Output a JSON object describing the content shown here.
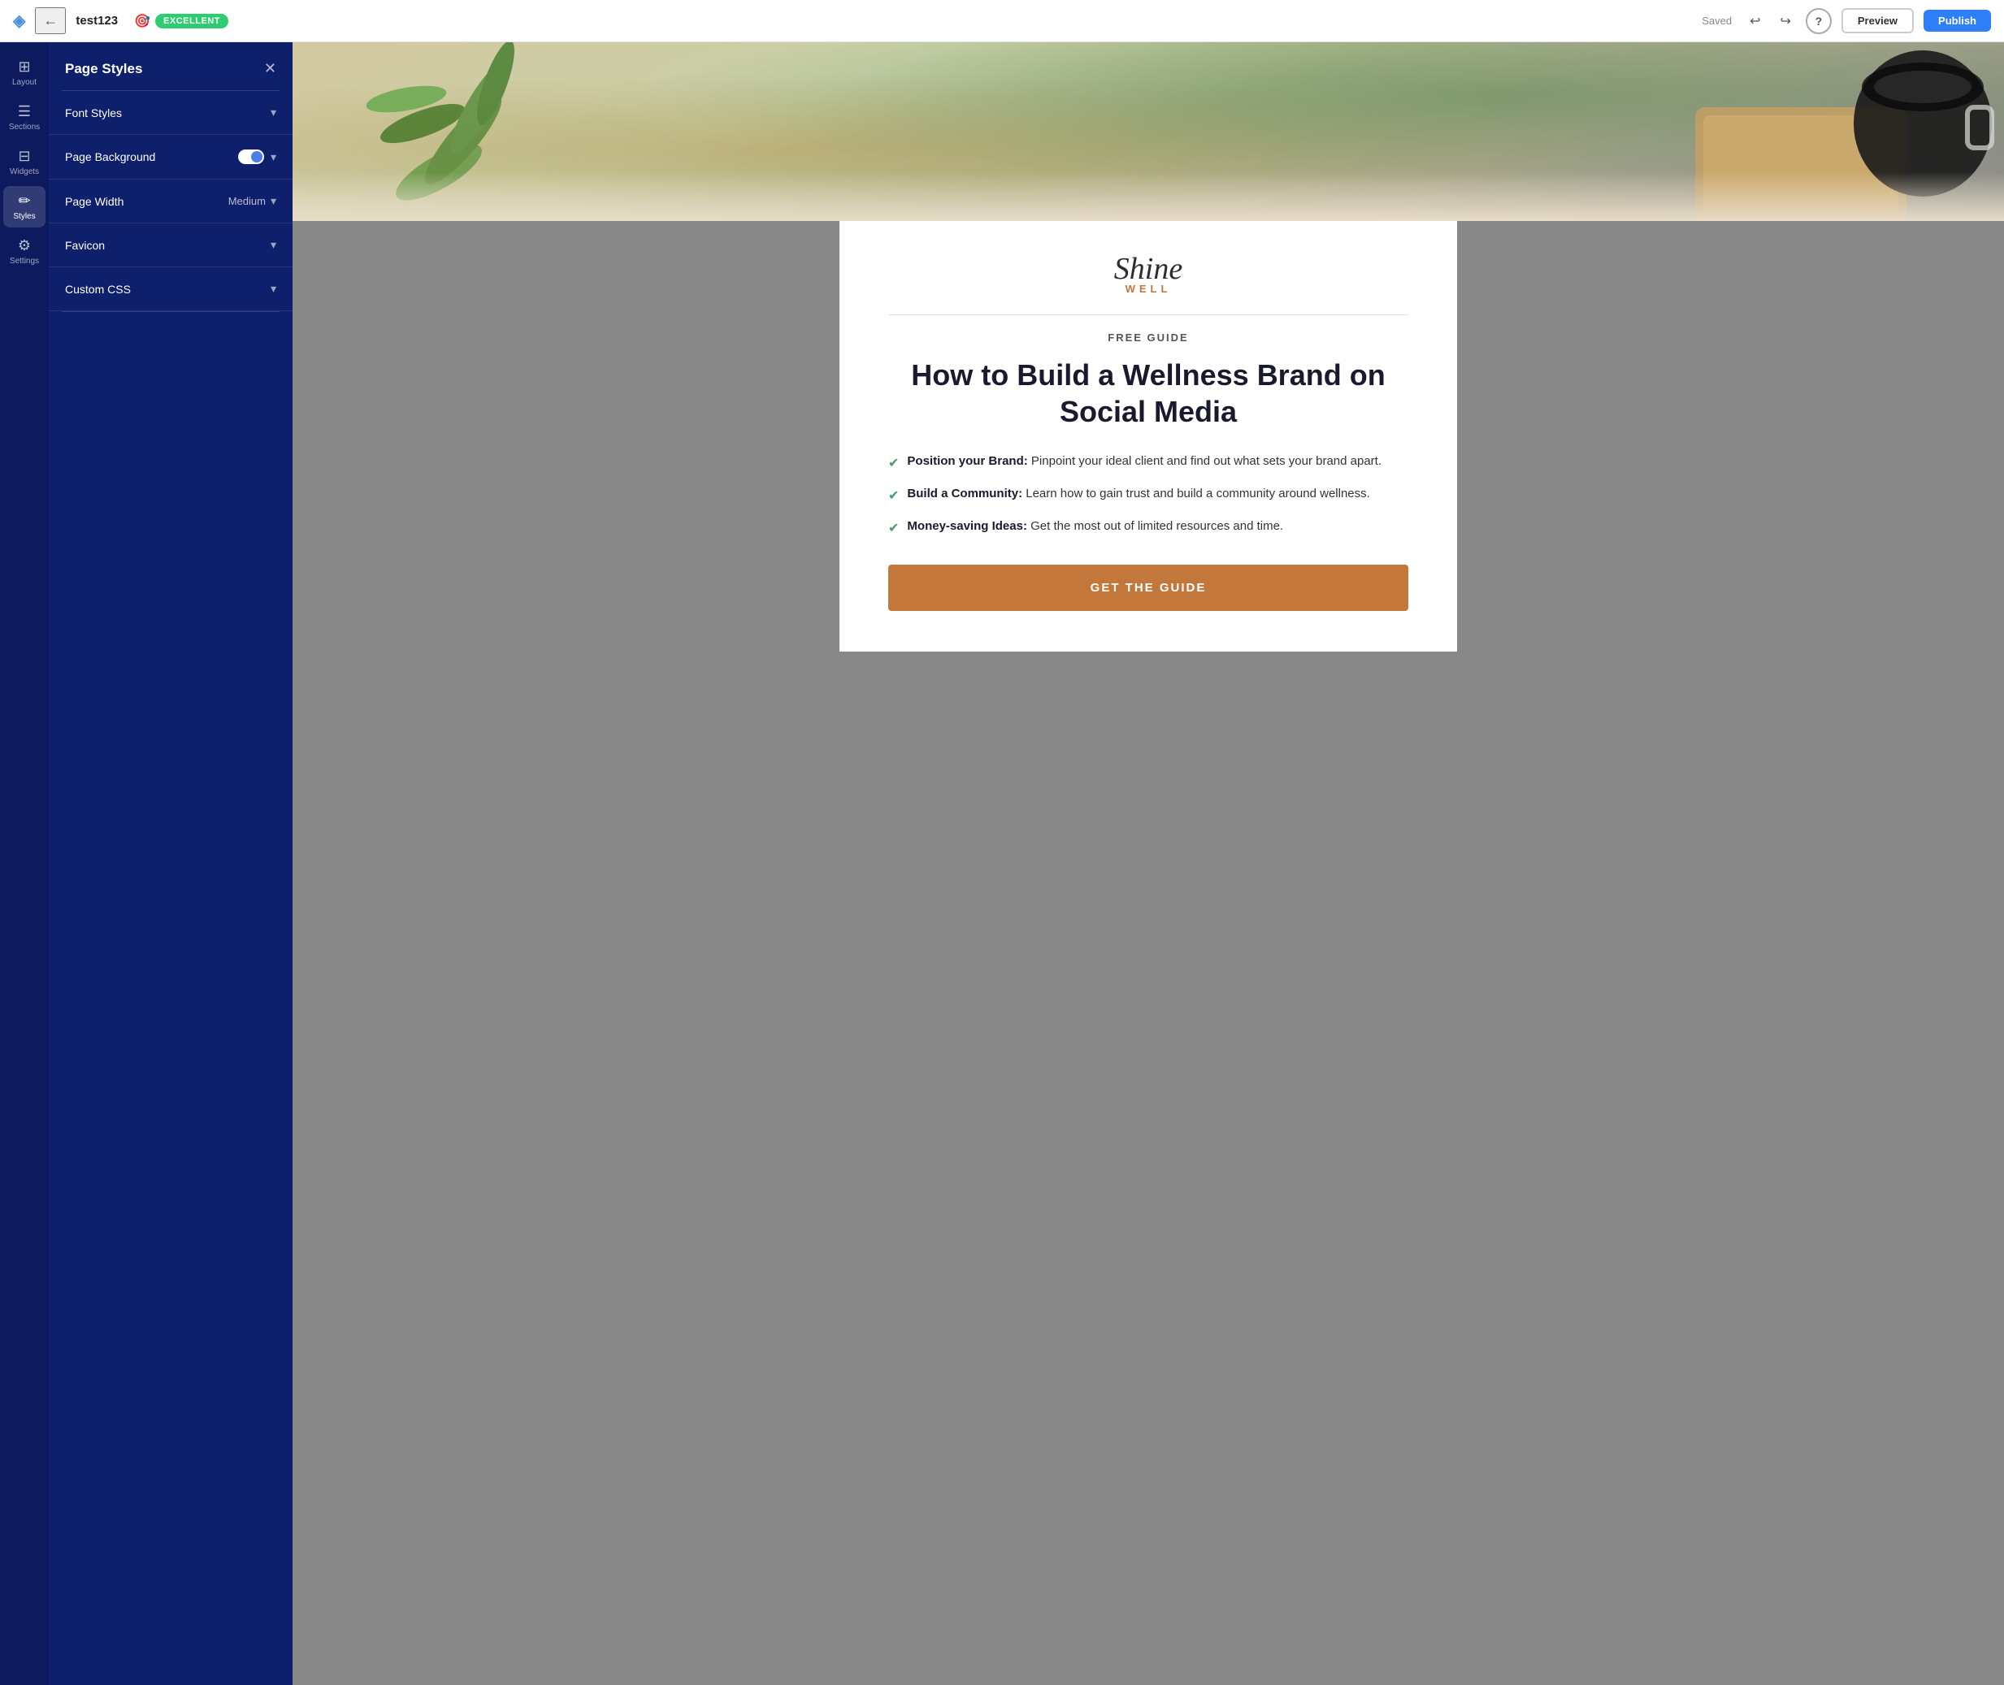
{
  "topbar": {
    "logo_symbol": "◈",
    "back_label": "←",
    "title": "test123",
    "target_icon": "⊕",
    "badge": "EXCELLENT",
    "saved_label": "Saved",
    "undo_label": "↩",
    "redo_label": "↪",
    "help_label": "?",
    "preview_label": "Preview",
    "publish_label": "Publish"
  },
  "icon_sidebar": {
    "items": [
      {
        "id": "layout",
        "icon": "⊞",
        "label": "Layout"
      },
      {
        "id": "sections",
        "icon": "≡",
        "label": "Sections"
      },
      {
        "id": "widgets",
        "icon": "⊟",
        "label": "Widgets"
      },
      {
        "id": "styles",
        "icon": "✏",
        "label": "Styles"
      },
      {
        "id": "settings",
        "icon": "⚙",
        "label": "Settings"
      }
    ]
  },
  "panel": {
    "title": "Page Styles",
    "close_label": "✕",
    "items": [
      {
        "id": "font-styles",
        "label": "Font Styles",
        "value": "",
        "has_toggle": false
      },
      {
        "id": "page-background",
        "label": "Page Background",
        "value": "",
        "has_toggle": true
      },
      {
        "id": "page-width",
        "label": "Page Width",
        "value": "Medium",
        "has_toggle": false
      },
      {
        "id": "favicon",
        "label": "Favicon",
        "value": "",
        "has_toggle": false
      },
      {
        "id": "custom-css",
        "label": "Custom CSS",
        "value": "",
        "has_toggle": false
      }
    ]
  },
  "landing": {
    "logo_script": "Shine",
    "logo_sub": "WELL",
    "tag": "FREE GUIDE",
    "headline": "How to Build a Wellness Brand on Social Media",
    "bullets": [
      {
        "bold": "Position your Brand:",
        "text": " Pinpoint your ideal client and find out what sets your brand apart."
      },
      {
        "bold": "Build a Community:",
        "text": " Learn how to gain trust and build a community around wellness."
      },
      {
        "bold": "Money-saving Ideas:",
        "text": " Get the most out of limited resources and time."
      }
    ],
    "cta_label": "GET THE GUIDE"
  }
}
